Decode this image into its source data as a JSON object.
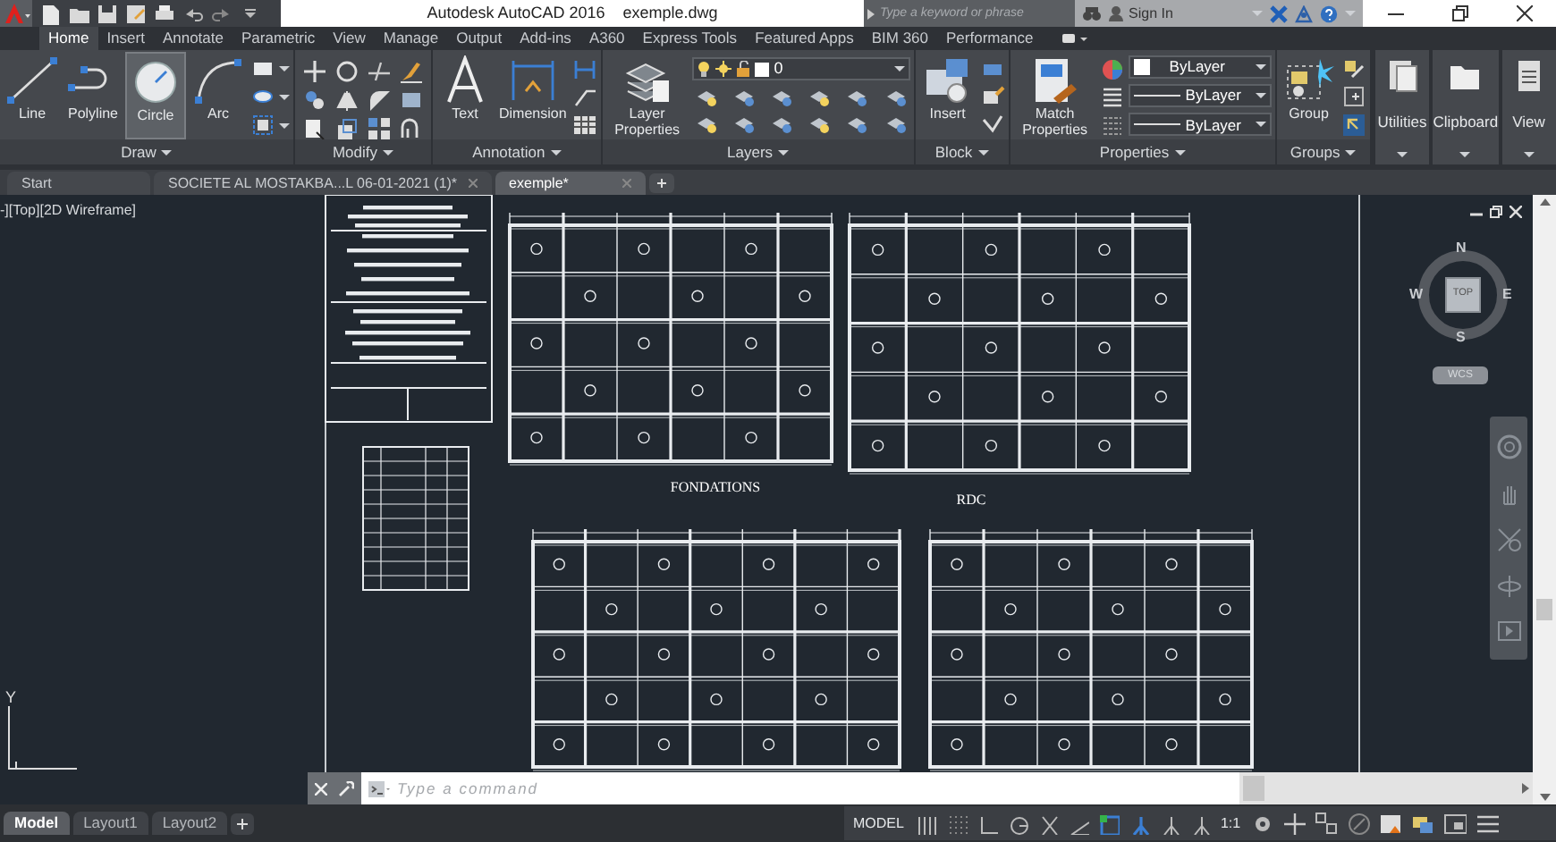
{
  "title_bar": {
    "title": "Autodesk AutoCAD 2016",
    "filename": "exemple.dwg",
    "search_placeholder": "Type a keyword or phrase",
    "sign_in": "Sign In"
  },
  "ribbon_tabs": [
    {
      "label": "Home",
      "selected": true
    },
    {
      "label": "Insert",
      "selected": false
    },
    {
      "label": "Annotate",
      "selected": false
    },
    {
      "label": "Parametric",
      "selected": false
    },
    {
      "label": "View",
      "selected": false
    },
    {
      "label": "Manage",
      "selected": false
    },
    {
      "label": "Output",
      "selected": false
    },
    {
      "label": "Add-ins",
      "selected": false
    },
    {
      "label": "A360",
      "selected": false
    },
    {
      "label": "Express Tools",
      "selected": false
    },
    {
      "label": "Featured Apps",
      "selected": false
    },
    {
      "label": "BIM 360",
      "selected": false
    },
    {
      "label": "Performance",
      "selected": false
    }
  ],
  "ribbon_panels": [
    {
      "kind": "draw",
      "title": "Draw",
      "tools": [
        {
          "label": "Line",
          "selected": false
        },
        {
          "label": "Polyline",
          "selected": false
        },
        {
          "label": "Circle",
          "selected": true
        },
        {
          "label": "Arc",
          "selected": false
        }
      ]
    },
    {
      "kind": "modify",
      "title": "Modify"
    },
    {
      "kind": "annotation",
      "title": "Annotation",
      "tools": [
        {
          "label": "Text",
          "selected": false
        },
        {
          "label": "Dimension",
          "selected": false
        }
      ]
    },
    {
      "kind": "layers",
      "title": "Layers",
      "tools": [
        {
          "label": "Layer Properties",
          "selected": false
        }
      ],
      "combos": [
        {
          "kind": "layer",
          "value": "0"
        }
      ]
    },
    {
      "kind": "block",
      "title": "Block",
      "tools": [
        {
          "label": "Insert",
          "selected": false
        }
      ]
    },
    {
      "kind": "properties",
      "title": "Properties",
      "tools": [
        {
          "label": "Match Properties",
          "selected": false
        }
      ],
      "combos": [
        {
          "kind": "color",
          "value": "ByLayer"
        },
        {
          "kind": "line",
          "value": "ByLayer"
        },
        {
          "kind": "line",
          "value": "ByLayer"
        }
      ]
    },
    {
      "kind": "groups",
      "title": "Groups",
      "tools": [
        {
          "label": "Group",
          "selected": false
        }
      ]
    },
    {
      "kind": "collapsed",
      "title": "Utilities"
    },
    {
      "kind": "collapsed",
      "title": "Clipboard"
    },
    {
      "kind": "collapsed",
      "title": "View"
    }
  ],
  "file_tabs": [
    {
      "label": "Start",
      "selected": false,
      "closable": false
    },
    {
      "label": "SOCIETE AL MOSTAKBA...L  06-01-2021 (1)*",
      "selected": false,
      "closable": true
    },
    {
      "label": "exemple*",
      "selected": true,
      "closable": true
    }
  ],
  "viewport": {
    "label": "-][Top][2D Wireframe]",
    "drawing_titles": [
      "FONDATIONS",
      "RDC"
    ],
    "ucs_axis": "Y"
  },
  "viewcube": {
    "top": "TOP",
    "north": "N",
    "south": "S",
    "east": "E",
    "west": "W",
    "coordinate_system": "WCS"
  },
  "command_line": {
    "placeholder": "Type a command"
  },
  "layout_tabs": [
    {
      "label": "Model",
      "selected": true
    },
    {
      "label": "Layout1",
      "selected": false
    },
    {
      "label": "Layout2",
      "selected": false
    }
  ],
  "status_bar": {
    "space": "MODEL",
    "scale": "1:1"
  }
}
